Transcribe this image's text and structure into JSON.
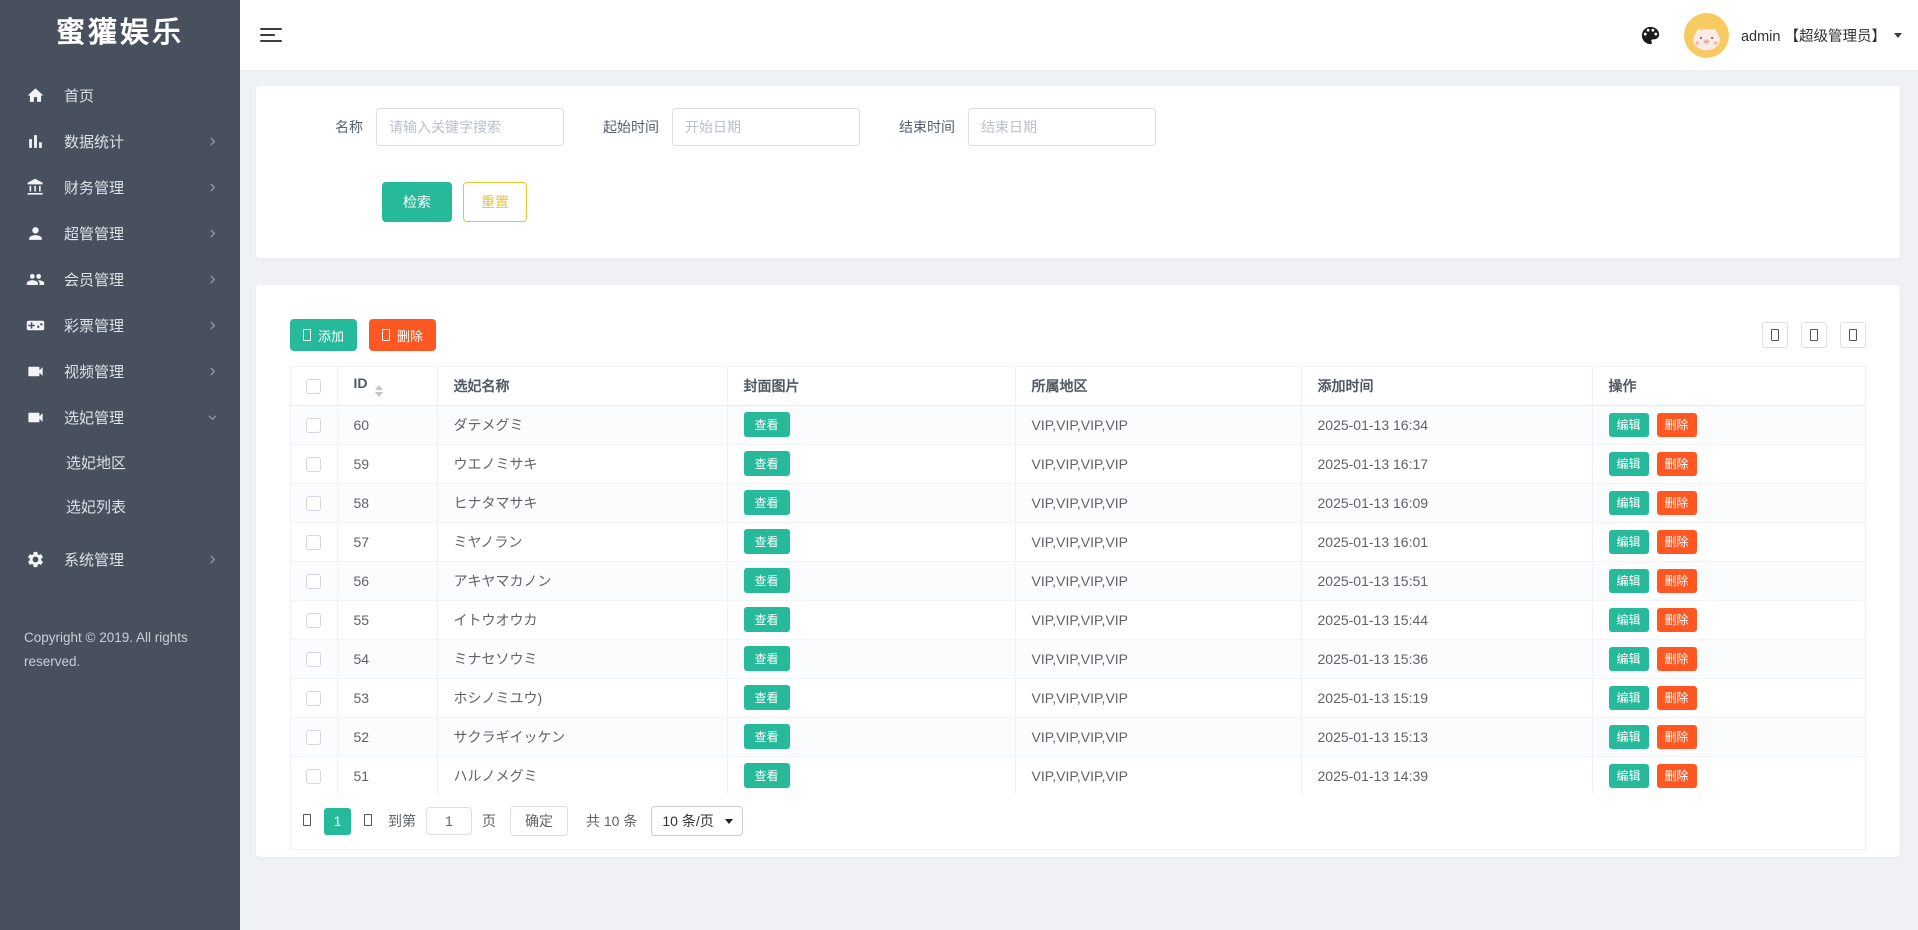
{
  "colors": {
    "teal": "#26b99a",
    "orange": "#ff5722",
    "yellow": "#eec22e",
    "sidebar_bg": "#48505e",
    "content_bg": "#f0f1f5"
  },
  "app": {
    "logo": "蜜獾娱乐",
    "copyright": "Copyright © 2019. All rights reserved."
  },
  "sidebar": {
    "items": [
      {
        "label": "首页",
        "icon": "home-icon",
        "arrow": ""
      },
      {
        "label": "数据统计",
        "icon": "bar-chart-icon",
        "arrow": "right"
      },
      {
        "label": "财务管理",
        "icon": "bank-icon",
        "arrow": "right"
      },
      {
        "label": "超管管理",
        "icon": "user-icon",
        "arrow": "right"
      },
      {
        "label": "会员管理",
        "icon": "users-icon",
        "arrow": "right"
      },
      {
        "label": "彩票管理",
        "icon": "gamepad-icon",
        "arrow": "right"
      },
      {
        "label": "视频管理",
        "icon": "video-icon",
        "arrow": "right"
      },
      {
        "label": "选妃管理",
        "icon": "video-icon",
        "arrow": "down",
        "children": [
          "选妃地区",
          "选妃列表"
        ]
      },
      {
        "label": "系统管理",
        "icon": "gear-icon",
        "arrow": "right",
        "gapped": true
      }
    ]
  },
  "topbar": {
    "user": "admin 【超级管理员】"
  },
  "search": {
    "name_label": "名称",
    "name_placeholder": "请输入关键字搜索",
    "start_label": "起始时间",
    "start_placeholder": "开始日期",
    "end_label": "结束时间",
    "end_placeholder": "结束日期",
    "search_btn": "检索",
    "reset_btn": "重置"
  },
  "table": {
    "add_btn": "添加",
    "delete_btn": "删除",
    "columns": [
      "ID",
      "选妃名称",
      "封面图片",
      "所属地区",
      "添加时间",
      "操作"
    ],
    "view_btn": "查看",
    "edit_btn": "编辑",
    "row_delete_btn": "删除",
    "rows": [
      {
        "id": "60",
        "name": "ダテメグミ",
        "region": "VIP,VIP,VIP,VIP",
        "time": "2025-01-13 16:34"
      },
      {
        "id": "59",
        "name": "ウエノミサキ",
        "region": "VIP,VIP,VIP,VIP",
        "time": "2025-01-13 16:17"
      },
      {
        "id": "58",
        "name": "ヒナタマサキ",
        "region": "VIP,VIP,VIP,VIP",
        "time": "2025-01-13 16:09"
      },
      {
        "id": "57",
        "name": "ミヤノラン",
        "region": "VIP,VIP,VIP,VIP",
        "time": "2025-01-13 16:01"
      },
      {
        "id": "56",
        "name": "アキヤマカノン",
        "region": "VIP,VIP,VIP,VIP",
        "time": "2025-01-13 15:51"
      },
      {
        "id": "55",
        "name": "イトウオウカ",
        "region": "VIP,VIP,VIP,VIP",
        "time": "2025-01-13 15:44"
      },
      {
        "id": "54",
        "name": "ミナセソウミ",
        "region": "VIP,VIP,VIP,VIP",
        "time": "2025-01-13 15:36"
      },
      {
        "id": "53",
        "name": "ホシノミユウ)",
        "region": "VIP,VIP,VIP,VIP",
        "time": "2025-01-13 15:19"
      },
      {
        "id": "52",
        "name": "サクラギイッケン",
        "region": "VIP,VIP,VIP,VIP",
        "time": "2025-01-13 15:13"
      },
      {
        "id": "51",
        "name": "ハルノメグミ",
        "region": "VIP,VIP,VIP,VIP",
        "time": "2025-01-13 14:39"
      }
    ]
  },
  "pagination": {
    "page": "1",
    "goto_label": "到第",
    "goto_value": "1",
    "unit_label": "页",
    "confirm_label": "确定",
    "total_label": "共 10 条",
    "per_page_label": "10 条/页"
  }
}
